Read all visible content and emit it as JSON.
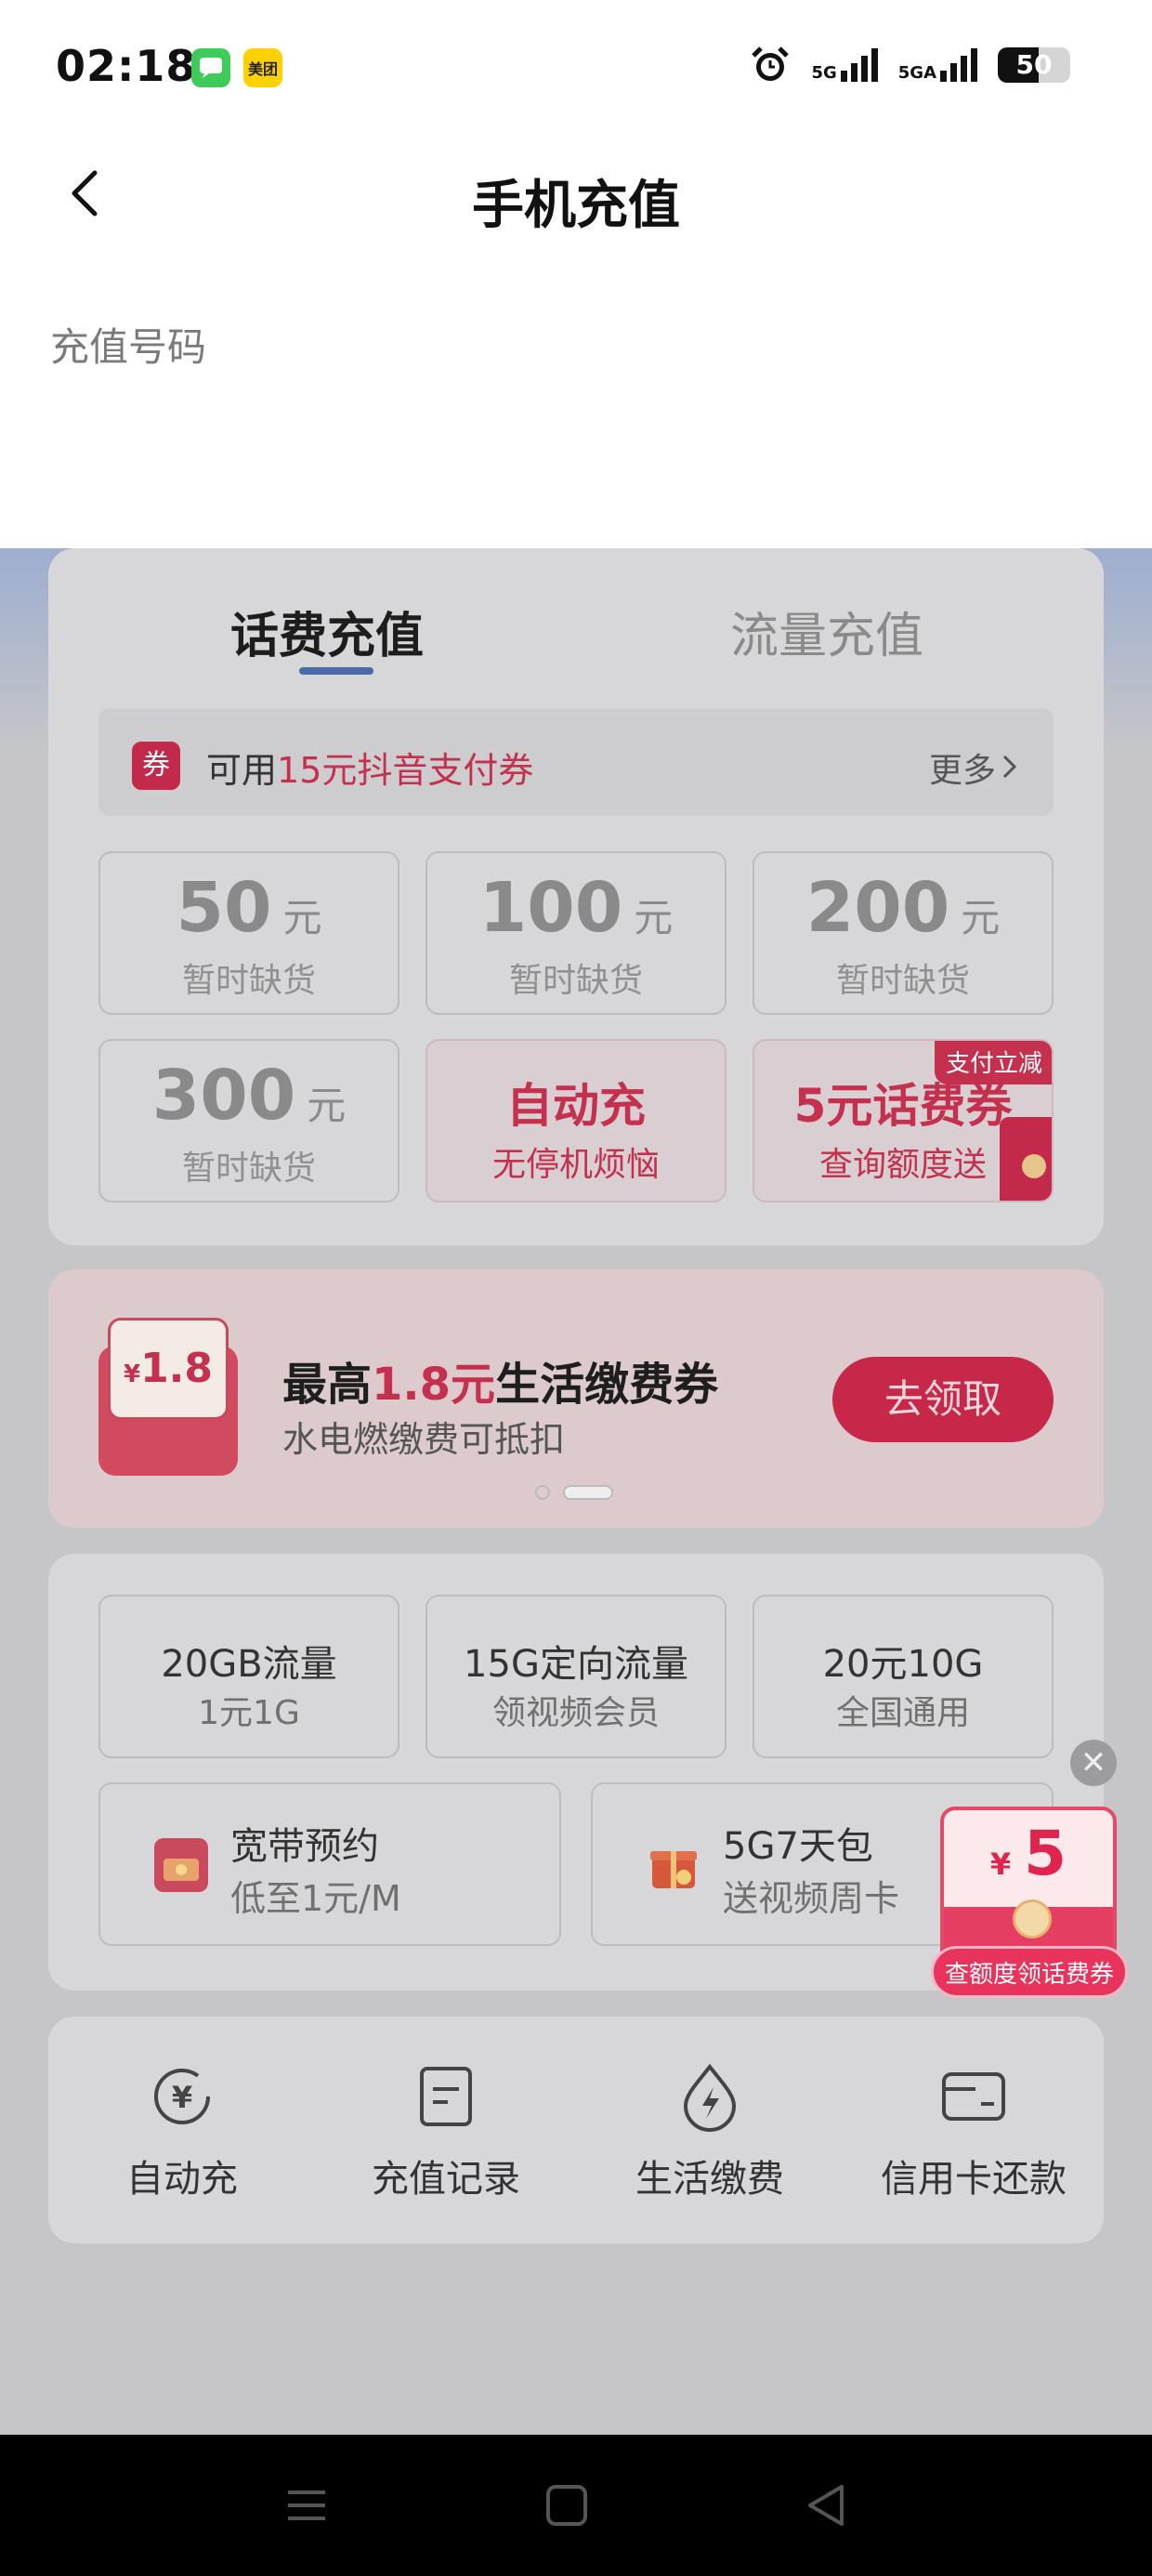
{
  "status_bar": {
    "time": "02:18",
    "apps": [
      "messages-icon",
      "meituan-icon"
    ],
    "meituan_label": "美团",
    "signal1_label": "5G",
    "signal2_label": "5GA",
    "battery": "50"
  },
  "nav": {
    "title": "手机充值",
    "back_icon": "back-arrow-icon"
  },
  "phone_section": {
    "label": "充值号码"
  },
  "tabs": [
    {
      "label": "话费充值",
      "active": true
    },
    {
      "label": "流量充值",
      "active": false
    }
  ],
  "coupon_bar": {
    "tag": "券",
    "prefix": "可用",
    "highlight": "15元抖音支付券",
    "more": "更多"
  },
  "amounts": [
    {
      "value": "50",
      "unit": "元",
      "status": "暂时缺货"
    },
    {
      "value": "100",
      "unit": "元",
      "status": "暂时缺货"
    },
    {
      "value": "200",
      "unit": "元",
      "status": "暂时缺货"
    },
    {
      "value": "300",
      "unit": "元",
      "status": "暂时缺货"
    }
  ],
  "promo_tiles": [
    {
      "title": "自动充",
      "subtitle": "无停机烦恼"
    },
    {
      "title": "5元话费券",
      "subtitle": "查询额度送",
      "corner": "支付立减"
    }
  ],
  "banner": {
    "badge_currency": "¥",
    "badge_amount": "1.8",
    "headline_prefix": "最高",
    "headline_highlight": "1.8元",
    "headline_suffix": "生活缴费券",
    "subline": "水电燃缴费可抵扣",
    "button": "去领取"
  },
  "packages": [
    {
      "title": "20GB流量",
      "desc": "1元1G"
    },
    {
      "title": "15G定向流量",
      "desc": "领视频会员"
    },
    {
      "title": "20元10G",
      "desc": "全国通用"
    }
  ],
  "packages_wide": [
    {
      "title": "宽带预约",
      "desc": "低至1元/M",
      "icon": "broadband-envelope-icon"
    },
    {
      "title": "5G7天包",
      "desc": "送视频周卡",
      "icon": "gift-box-icon"
    }
  ],
  "quick_entries": [
    {
      "label": "自动充",
      "icon": "auto-recharge-icon"
    },
    {
      "label": "充值记录",
      "icon": "record-doc-icon"
    },
    {
      "label": "生活缴费",
      "icon": "utility-bolt-icon"
    },
    {
      "label": "信用卡还款",
      "icon": "credit-card-icon"
    }
  ],
  "floating_promo": {
    "currency": "¥",
    "amount": "5",
    "tag": "查额度领话费券",
    "close": "✕"
  },
  "colors": {
    "accent_red": "#c4304e",
    "tab_underline": "#4a6aa8",
    "dim_overlay": "#c6c6c8"
  }
}
